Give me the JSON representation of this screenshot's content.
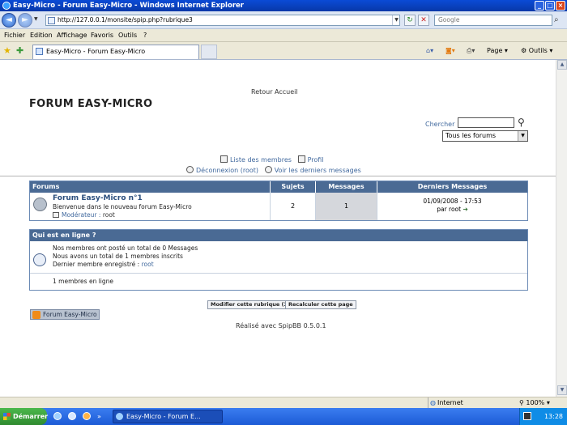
{
  "window": {
    "title": "Easy-Micro - Forum Easy-Micro - Windows Internet Explorer",
    "address": "http://127.0.0.1/monsite/spip.php?rubrique3",
    "search_placeholder": "Google"
  },
  "menu": [
    "Fichier",
    "Edition",
    "Affichage",
    "Favoris",
    "Outils",
    "?"
  ],
  "tab": {
    "title": "Easy-Micro - Forum Easy-Micro"
  },
  "toolbar": {
    "page_label": "Page",
    "tools_label": "Outils"
  },
  "page": {
    "retour": "Retour Accueil",
    "title": "FORUM EASY-MICRO",
    "search_label": "Chercher",
    "search_select": "Tous les forums",
    "links": {
      "members": "Liste des membres",
      "profile": "Profil",
      "logout": "Déconnexion (root)",
      "last_messages": "Voir les derniers messages"
    },
    "forum_table": {
      "headers": [
        "Forums",
        "Sujets",
        "Messages",
        "Derniers Messages"
      ],
      "row": {
        "name": "Forum Easy-Micro n°1",
        "description": "Bienvenue dans le nouveau forum Easy-Micro",
        "moderator_label": "Modérateur :",
        "moderator": "root",
        "sujets": "2",
        "messages": "1",
        "last_date": "01/09/2008 - 17:53",
        "last_by_label": "par",
        "last_by": "root"
      }
    },
    "who_table": {
      "header": "Qui est en ligne ?",
      "line1": "Nos membres ont posté un total de 0 Messages",
      "line2": "Nous avons un total de 1 membres inscrits",
      "line3_label": "Dernier membre enregistré :",
      "line3_user": "root",
      "online": "1 membres en ligne"
    },
    "buttons": {
      "modify": "Modifier cette rubrique (3)",
      "recalc": "Recalculer cette page"
    },
    "rss": "Forum Easy-Micro",
    "footer": "Réalisé avec SpipBB 0.5.0.1"
  },
  "status": {
    "zone": "Internet",
    "zoom": "100%"
  },
  "taskbar": {
    "start": "Démarrer",
    "task": "Easy-Micro - Forum E...",
    "time": "13:28"
  }
}
